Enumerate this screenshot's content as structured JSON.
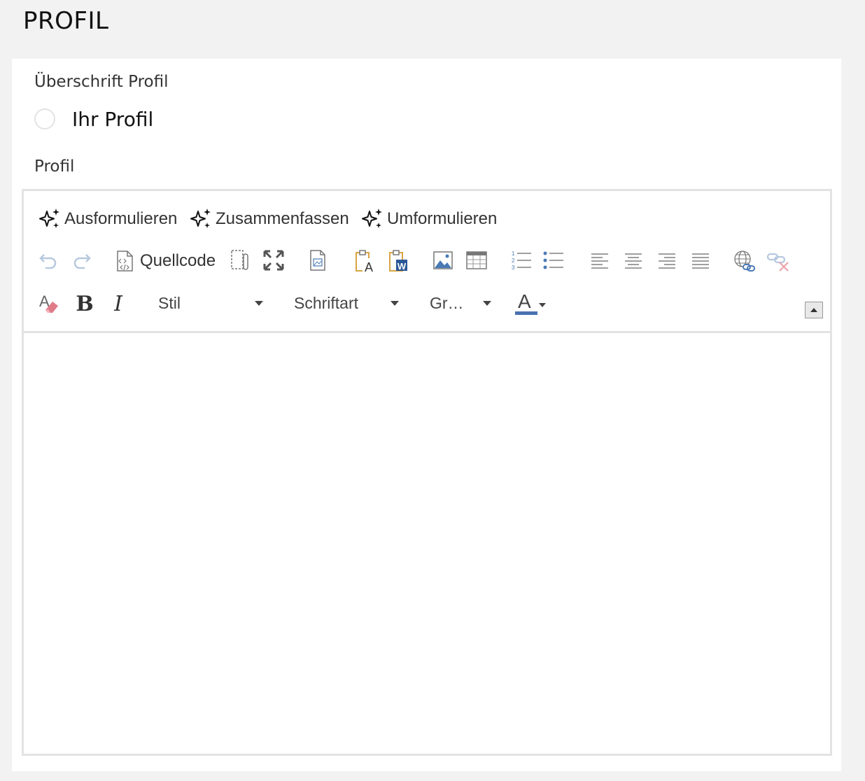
{
  "page": {
    "title": "PROFIL"
  },
  "heading_field": {
    "label": "Überschrift Profil",
    "option_label": "Ihr Profil"
  },
  "profile_field": {
    "label": "Profil",
    "content": ""
  },
  "ai_actions": [
    "Ausformulieren",
    "Zusammenfassen",
    "Umformulieren"
  ],
  "toolbar": {
    "source_label": "Quellcode",
    "style_combo": "Stil",
    "font_combo": "Schriftart",
    "size_combo": "Gr…",
    "font_color_letter": "A"
  },
  "colors": {
    "background": "#f2f2f2",
    "card": "#ffffff",
    "border": "#e3e3e3",
    "icon_blue": "#4a7ab5",
    "text_color_bar": "#4a72b0"
  }
}
